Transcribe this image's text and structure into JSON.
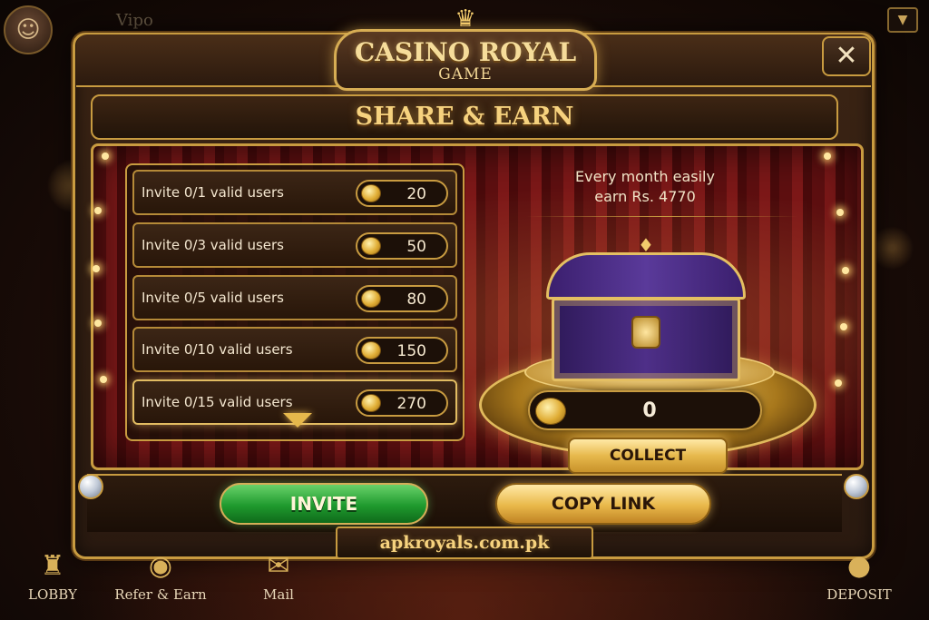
{
  "top": {
    "vip_label": "Vipo"
  },
  "header": {
    "logo_title": "CASINO ROYAL",
    "logo_sub": "GAME",
    "close_symbol": "✕"
  },
  "subtitle": "SHARE & EARN",
  "invites": [
    {
      "label": "Invite 0/1 valid users",
      "reward": "20"
    },
    {
      "label": "Invite 0/3 valid users",
      "reward": "50"
    },
    {
      "label": "Invite 0/5 valid users",
      "reward": "80"
    },
    {
      "label": "Invite 0/10 valid users",
      "reward": "150"
    },
    {
      "label": "Invite 0/15 valid users",
      "reward": "270"
    }
  ],
  "earn": {
    "line1": "Every month easily",
    "line2": "earn Rs. 4770"
  },
  "balance": "0",
  "buttons": {
    "collect": "COLLECT",
    "invite": "INVITE",
    "copy_link": "COPY LINK"
  },
  "site": "apkroyals.com.pk",
  "nav": [
    {
      "label": "LOBBY",
      "icon": "palace-icon"
    },
    {
      "label": "Refer & Earn",
      "icon": "coins-stack-icon"
    },
    {
      "label": "Mail",
      "icon": "mail-icon"
    },
    {
      "label": "DEPOSIT",
      "icon": "coin-pile-icon"
    }
  ],
  "colors": {
    "gold": "#c89b40",
    "green": "#1f9a2e",
    "curtain": "#7d1818",
    "chest_purple": "#4e2f88"
  }
}
